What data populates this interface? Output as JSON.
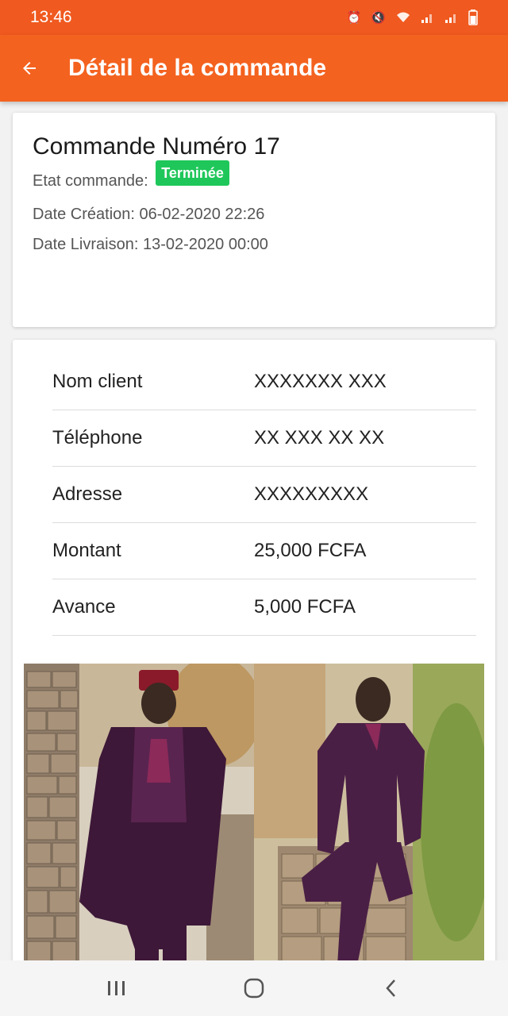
{
  "status_bar": {
    "time": "13:46",
    "icons": [
      "alarm-icon",
      "mute-icon",
      "wifi-icon",
      "signal-icon",
      "signal-icon",
      "battery-icon"
    ]
  },
  "app_bar": {
    "title": "Détail de la commande",
    "back_icon": "arrow-left-icon"
  },
  "order": {
    "title": "Commande Numéro 17",
    "state_label": "Etat commande:",
    "state_badge": "Terminée",
    "created": "Date Création: 06-02-2020 22:26",
    "delivery": "Date Livraison: 13-02-2020 00:00"
  },
  "details": [
    {
      "label": "Nom client",
      "value": "XXXXXXX XXX"
    },
    {
      "label": "Téléphone",
      "value": "XX XXX XX XX"
    },
    {
      "label": "Adresse",
      "value": "XXXXXXXXX"
    },
    {
      "label": "Montant",
      "value": "25,000 FCFA"
    },
    {
      "label": "Avance",
      "value": "5,000 FCFA"
    }
  ],
  "colors": {
    "primary": "#f4621f",
    "status_bar": "#f0591f",
    "badge": "#1fc75a",
    "garment": "#4a1f45"
  },
  "nav_bar": {
    "icons": [
      "recent-apps-icon",
      "home-icon",
      "back-icon"
    ]
  }
}
